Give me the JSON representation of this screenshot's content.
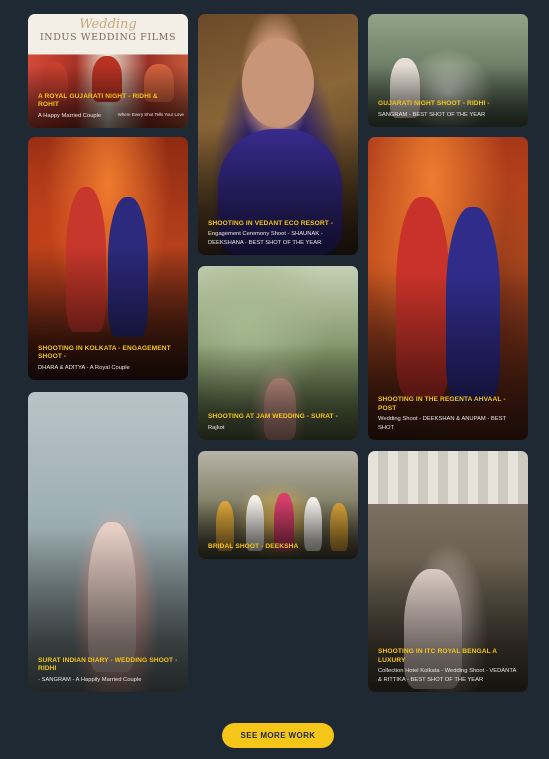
{
  "portfolio": {
    "cards": [
      {
        "title": "A ROYAL GUJARATI NIGHT - RIDHI & ROHIT",
        "subtitle": "A Happy Married Couple",
        "banner_script": "Wedding",
        "banner_name": "INDUS WEDDING FILMS",
        "banner_tag": "Where Every Shot Tells Your Love"
      },
      {
        "title": "SHOOTING IN KOLKATA - ENGAGEMENT SHOOT -",
        "subtitle": "DHARA & ADITYA - A Royal Couple"
      },
      {
        "title": "SURAT INDIAN DIARY - WEDDING SHOOT - RIDHI",
        "subtitle": "- SANGRAM - A Happily Married Couple"
      },
      {
        "title": "SHOOTING IN VEDANT ECO RESORT -",
        "subtitle": "Engagement Ceremony Shoot - SHAUNAK - DEEKSHANA - BEST SHOT OF THE YEAR"
      },
      {
        "title": "SHOOTING AT JAM WEDDING - SURAT -",
        "subtitle": "Rajkot"
      },
      {
        "title": "BRIDAL SHOOT - DEEKSHA",
        "subtitle": ""
      },
      {
        "title": "GUJARATI NIGHT SHOOT - RIDHI -",
        "subtitle": "SANGRAM - BEST SHOT OF THE YEAR"
      },
      {
        "title": "SHOOTING IN THE REGENTA AHVAAL - POST",
        "subtitle": "Wedding Shoot - DEEKSHAN & ANUPAM - BEST SHOT"
      },
      {
        "title": "SHOOTING IN ITC ROYAL BENGAL A LUXURY",
        "subtitle": "Collection Hotel Kolkata - Wedding Shoot - VEDANTA & RITTIKA - BEST SHOT OF THE YEAR"
      }
    ],
    "see_more_label": "SEE MORE WORK"
  },
  "colors": {
    "background": "#1f2934",
    "accent": "#f5c518",
    "caption_text": "#e9e6e2"
  }
}
